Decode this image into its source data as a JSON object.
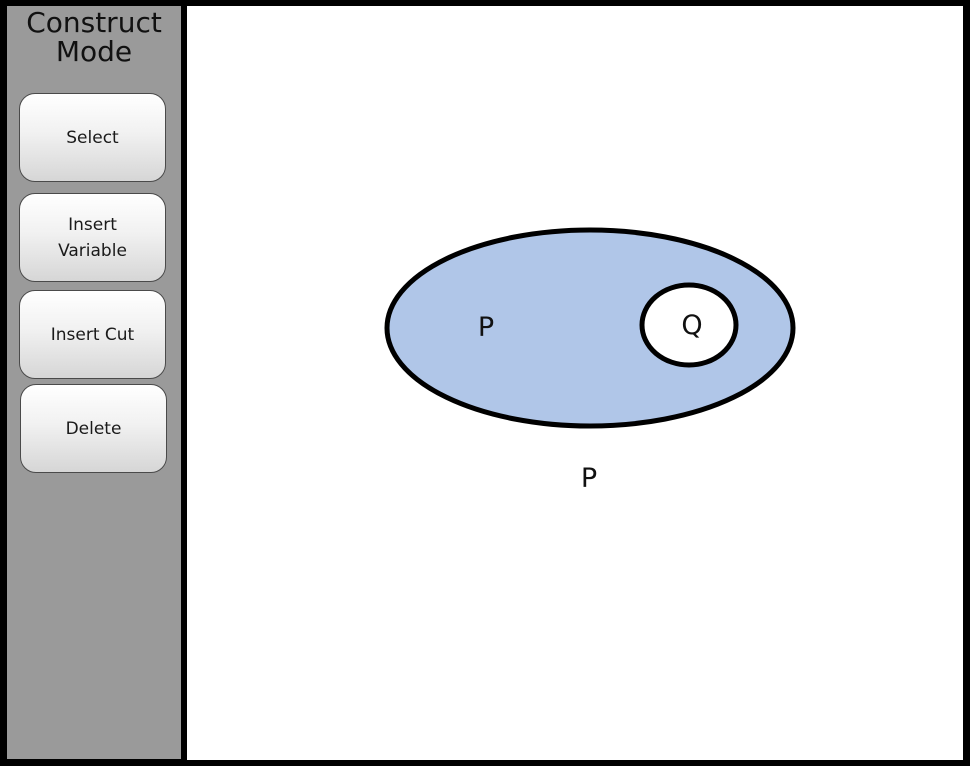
{
  "sidebar": {
    "title_line1": "Construct",
    "title_line2": "Mode",
    "buttons": [
      {
        "label": "Select"
      },
      {
        "label": "Insert\nVariable"
      },
      {
        "label": "Insert Cut"
      },
      {
        "label": "Delete"
      }
    ]
  },
  "canvas": {
    "outer_cut_fill": "#b0c6e8",
    "inner_cut_fill": "#ffffff",
    "labels": {
      "outer_var": "P",
      "inner_var": "Q",
      "sheet_var": "P"
    }
  }
}
